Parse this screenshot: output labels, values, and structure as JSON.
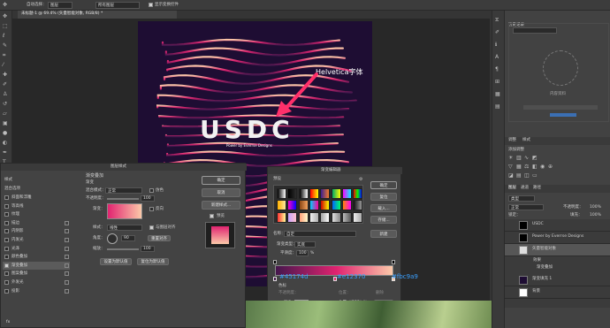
{
  "options_bar": {
    "auto_select_label": "自动选择：",
    "auto_select_value": "图层",
    "transform_value": "所有图层",
    "show_transform_label": "显示变换控件"
  },
  "doc_tab": {
    "title": "未标题-1 @ 69.4% (矢量智能对象, RGB/8) *"
  },
  "canvas": {
    "annotation": "Helvetica字体",
    "big_text": "USDC",
    "sub_text": "Power by Everrse Designs"
  },
  "layer_style": {
    "title": "图层样式",
    "styles_header": "样式",
    "blend_options": "混合选项",
    "items": [
      "斜面和浮雕",
      "等高线",
      "纹理",
      "描边",
      "内阴影",
      "内发光",
      "光泽",
      "颜色叠加",
      "渐变叠加",
      "图案叠加",
      "外发光",
      "投影"
    ],
    "section_title": "渐变叠加",
    "section_sub": "渐变",
    "blend_mode_label": "混合模式：",
    "blend_mode_value": "正常",
    "dither_label": "仿色",
    "opacity_label": "不透明度：",
    "opacity_value": "100",
    "gradient_label": "渐变：",
    "reverse_label": "反向",
    "style_label": "样式：",
    "style_value": "线性",
    "align_label": "与图层对齐",
    "angle_label": "角度：",
    "angle_value": "90",
    "reset_align": "重置对齐",
    "scale_label": "缩放：",
    "scale_value": "100",
    "set_default": "设置为默认值",
    "reset_default": "复位为默认值",
    "ok": "确定",
    "cancel": "取消",
    "new_style": "新建样式...",
    "preview": "预览",
    "bottom_label": "fx"
  },
  "gradient_editor": {
    "title": "渐变编辑器",
    "presets_label": "预设",
    "ok": "确定",
    "reset": "复位",
    "load": "载入...",
    "save": "存储...",
    "name_label": "名称：",
    "name_value": "自定",
    "new": "新建",
    "type_label": "渐变类型：",
    "type_value": "实底",
    "smooth_label": "平滑度：",
    "smooth_value": "100",
    "stop1": "#45174d",
    "stop2": "#e12370",
    "stop3": "#fbc9a9",
    "stops_header": "色标",
    "opacity_l": "不透明度：",
    "loc_l": "位置：",
    "delete_l": "删除",
    "color_l": "颜色：",
    "loc_v": "100",
    "pct": "%"
  },
  "right_panel": {
    "tabs": [
      "历史记录"
    ],
    "lib_label": "内容资料",
    "adjust_tab": "调整",
    "styles_tab": "样式",
    "add_adjust": "添加调整",
    "layers_tab": "图层",
    "channels_tab": "通道",
    "paths_tab": "路径",
    "kind_label": "类型",
    "normal": "正常",
    "opacity": "不透明度：",
    "opacity_val": "100%",
    "lock": "锁定：",
    "fill": "填充：",
    "fill_val": "100%",
    "layers": [
      "USDC",
      "Power by Everrse Designs",
      "矢量智能对象",
      "效果",
      "渐变叠加",
      "渐变填充 1",
      "背景"
    ]
  },
  "colors": {
    "g1": "#45174d",
    "g2": "#e12370",
    "g3": "#fbc9a9",
    "canvas_bg": "#1e0d33"
  }
}
